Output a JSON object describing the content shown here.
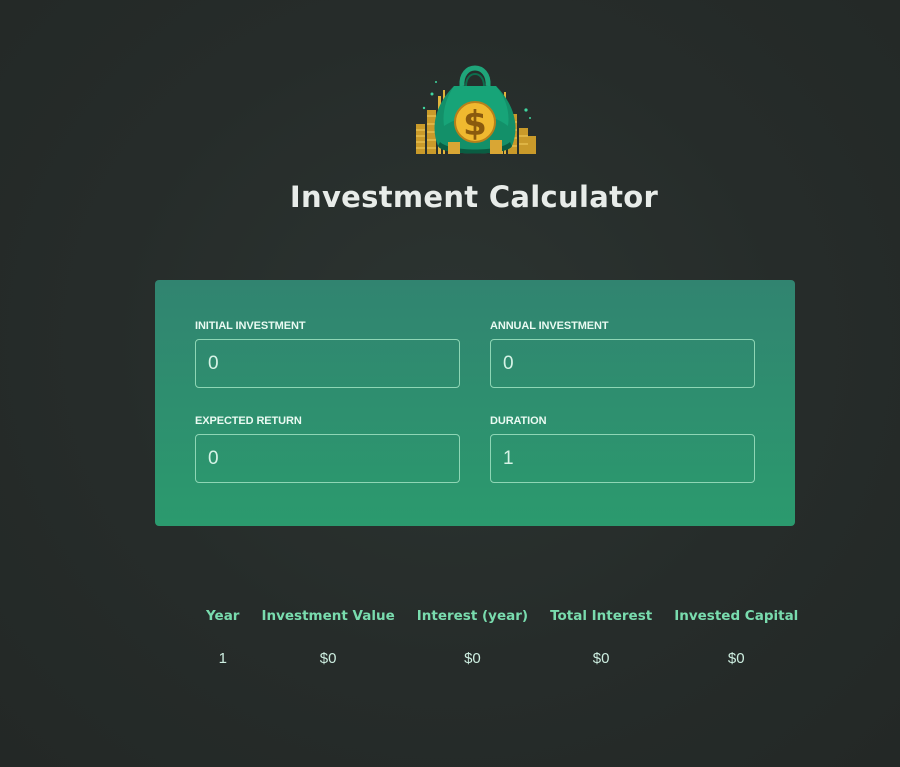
{
  "header": {
    "title": "Investment Calculator",
    "logo_icon": "money-bag-dollar-icon"
  },
  "colors": {
    "background": "#262c2a",
    "card_top": "#318470",
    "card_bottom": "#2b9a6e",
    "accent_text": "#79dcae"
  },
  "form": {
    "initial_investment": {
      "label": "Initial Investment",
      "value": "0"
    },
    "annual_investment": {
      "label": "Annual Investment",
      "value": "0"
    },
    "expected_return": {
      "label": "Expected Return",
      "value": "0"
    },
    "duration": {
      "label": "Duration",
      "value": "1"
    }
  },
  "results": {
    "columns": [
      "Year",
      "Investment Value",
      "Interest (year)",
      "Total Interest",
      "Invested Capital"
    ],
    "rows": [
      [
        "1",
        "$0",
        "$0",
        "$0",
        "$0"
      ]
    ]
  }
}
